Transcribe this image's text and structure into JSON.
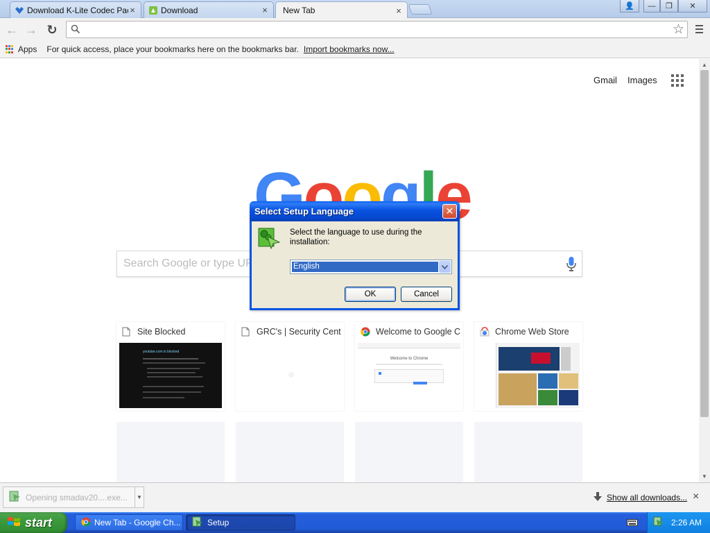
{
  "browser": {
    "tabs": [
      {
        "label": "Download K-Lite Codec Pack",
        "close": "×",
        "active": false
      },
      {
        "label": "Download",
        "close": "×",
        "active": false
      },
      {
        "label": "New Tab",
        "close": "×",
        "active": true
      }
    ],
    "window_controls": {
      "profile": "👤",
      "minimize": "—",
      "restore": "❐",
      "close": "✕"
    },
    "toolbar": {
      "back": "←",
      "forward": "→",
      "reload": "↻",
      "omnibox_value": "",
      "star": "☆"
    },
    "bookmarks_bar": {
      "apps_label": "Apps",
      "hint": "For quick access, place your bookmarks here on the bookmarks bar.",
      "import_link": "Import bookmarks now..."
    }
  },
  "newtab": {
    "links": {
      "gmail": "Gmail",
      "images": "Images"
    },
    "logo_letters": [
      {
        "char": "G",
        "color": "#4285f4"
      },
      {
        "char": "o",
        "color": "#ea4335"
      },
      {
        "char": "o",
        "color": "#fbbc05"
      },
      {
        "char": "g",
        "color": "#4285f4"
      },
      {
        "char": "l",
        "color": "#34a853"
      },
      {
        "char": "e",
        "color": "#ea4335"
      }
    ],
    "search_placeholder": "Search Google or type URL",
    "tiles": [
      {
        "title": "Site Blocked",
        "thumb_text": "youtube.com is blocked"
      },
      {
        "title": "GRC's | Security Cent"
      },
      {
        "title": "Welcome to Google C",
        "thumb_text": "Welcome to Chrome"
      },
      {
        "title": "Chrome Web Store"
      }
    ]
  },
  "download_shelf": {
    "item_label": "Opening smadav20....exe...",
    "show_all": "Show all downloads...",
    "close": "×"
  },
  "dialog": {
    "title": "Select Setup Language",
    "close": "✕",
    "message": "Select the language to use during the installation:",
    "selected_language": "English",
    "ok_label": "OK",
    "cancel_label": "Cancel"
  },
  "taskbar": {
    "start_label": "start",
    "tasks": [
      {
        "label": "New Tab - Google Ch..."
      },
      {
        "label": "Setup"
      }
    ],
    "clock": "2:26 AM"
  }
}
